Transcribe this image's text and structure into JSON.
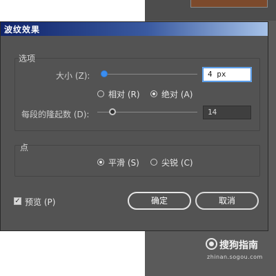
{
  "dialog": {
    "title": "波纹效果",
    "options_group": "选项",
    "size_label": "大小 (Z):",
    "size_value": "4 px",
    "radio_relative": "相对 (R)",
    "radio_absolute": "绝对 (A)",
    "selected_mode": "absolute",
    "ridges_label": "每段的隆起数 (D):",
    "ridges_value": "14",
    "points_group": "点",
    "radio_smooth": "平滑 (S)",
    "radio_corner": "尖锐 (C)",
    "selected_point": "smooth",
    "preview_label": "预览 (P)",
    "preview_checked": true,
    "ok_label": "确定",
    "cancel_label": "取消"
  },
  "watermark": {
    "text": "搜狗指南",
    "url": "zhinan.sogou.com"
  },
  "colors": {
    "dialog_bg": "#535353",
    "title_gradient_start": "#10246a",
    "title_gradient_end": "#a6c2e8",
    "slider_accent": "#3b8ef0"
  }
}
